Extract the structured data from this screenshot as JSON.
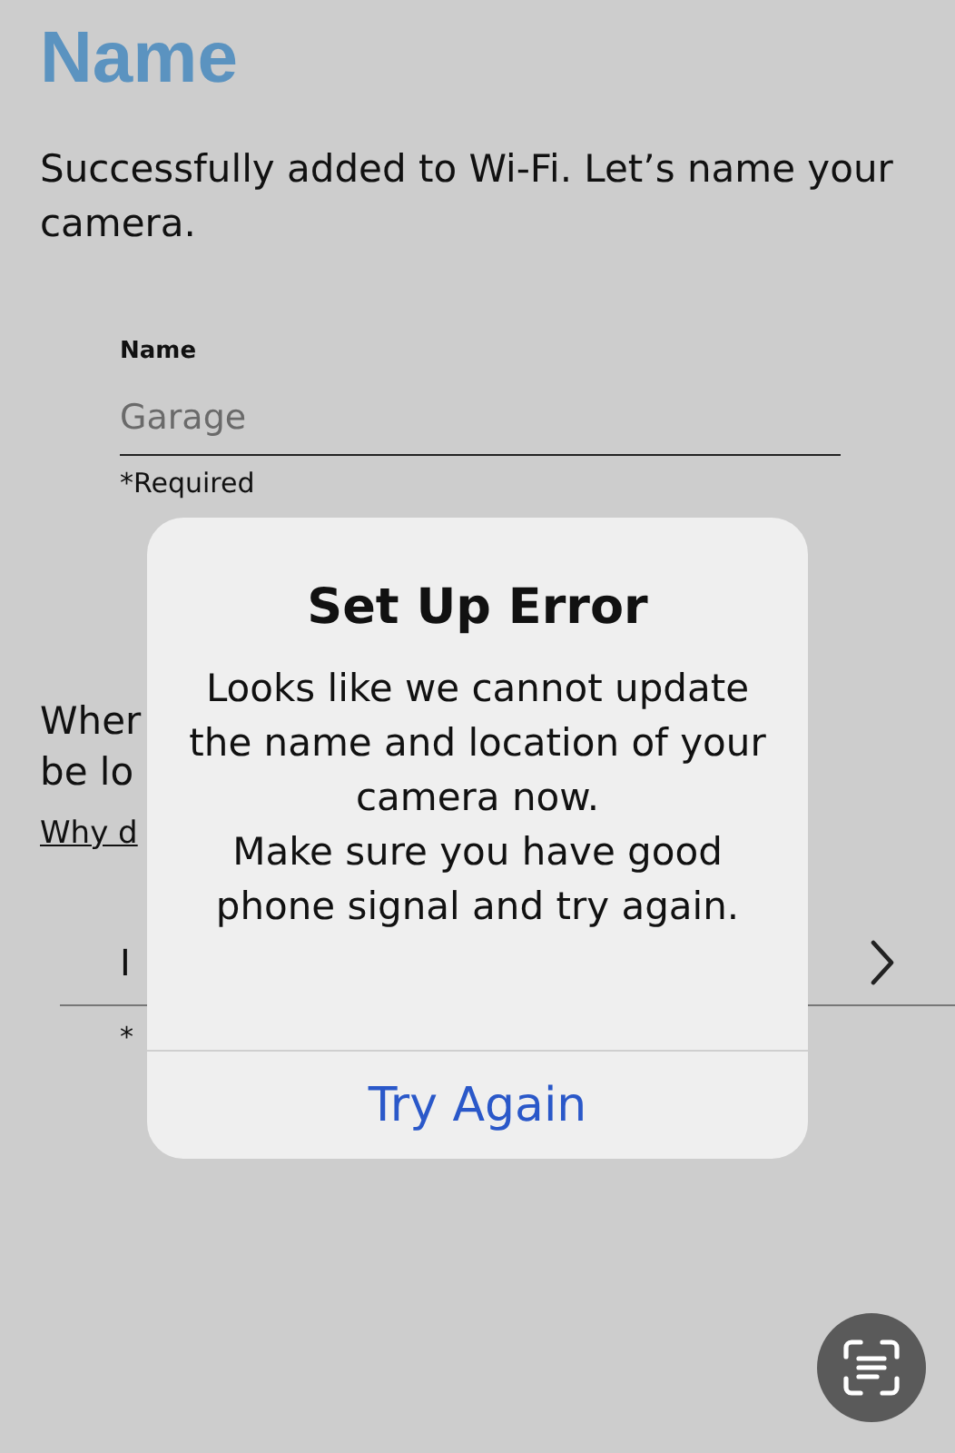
{
  "page": {
    "title": "Name",
    "subtitle": "Successfully added to Wi-Fi. Let’s name your camera."
  },
  "name_field": {
    "label": "Name",
    "placeholder": "Garage",
    "note": "*Required"
  },
  "hidden_section": {
    "line_1": "Wher",
    "line_2": "be lo",
    "link": "Why d",
    "row_label": "I",
    "row_note": "*"
  },
  "alert": {
    "title": "Set Up Error",
    "message": "Looks like we cannot update the name and location of your camera now.\nMake sure you have good phone signal and try again.",
    "button": "Try Again"
  }
}
